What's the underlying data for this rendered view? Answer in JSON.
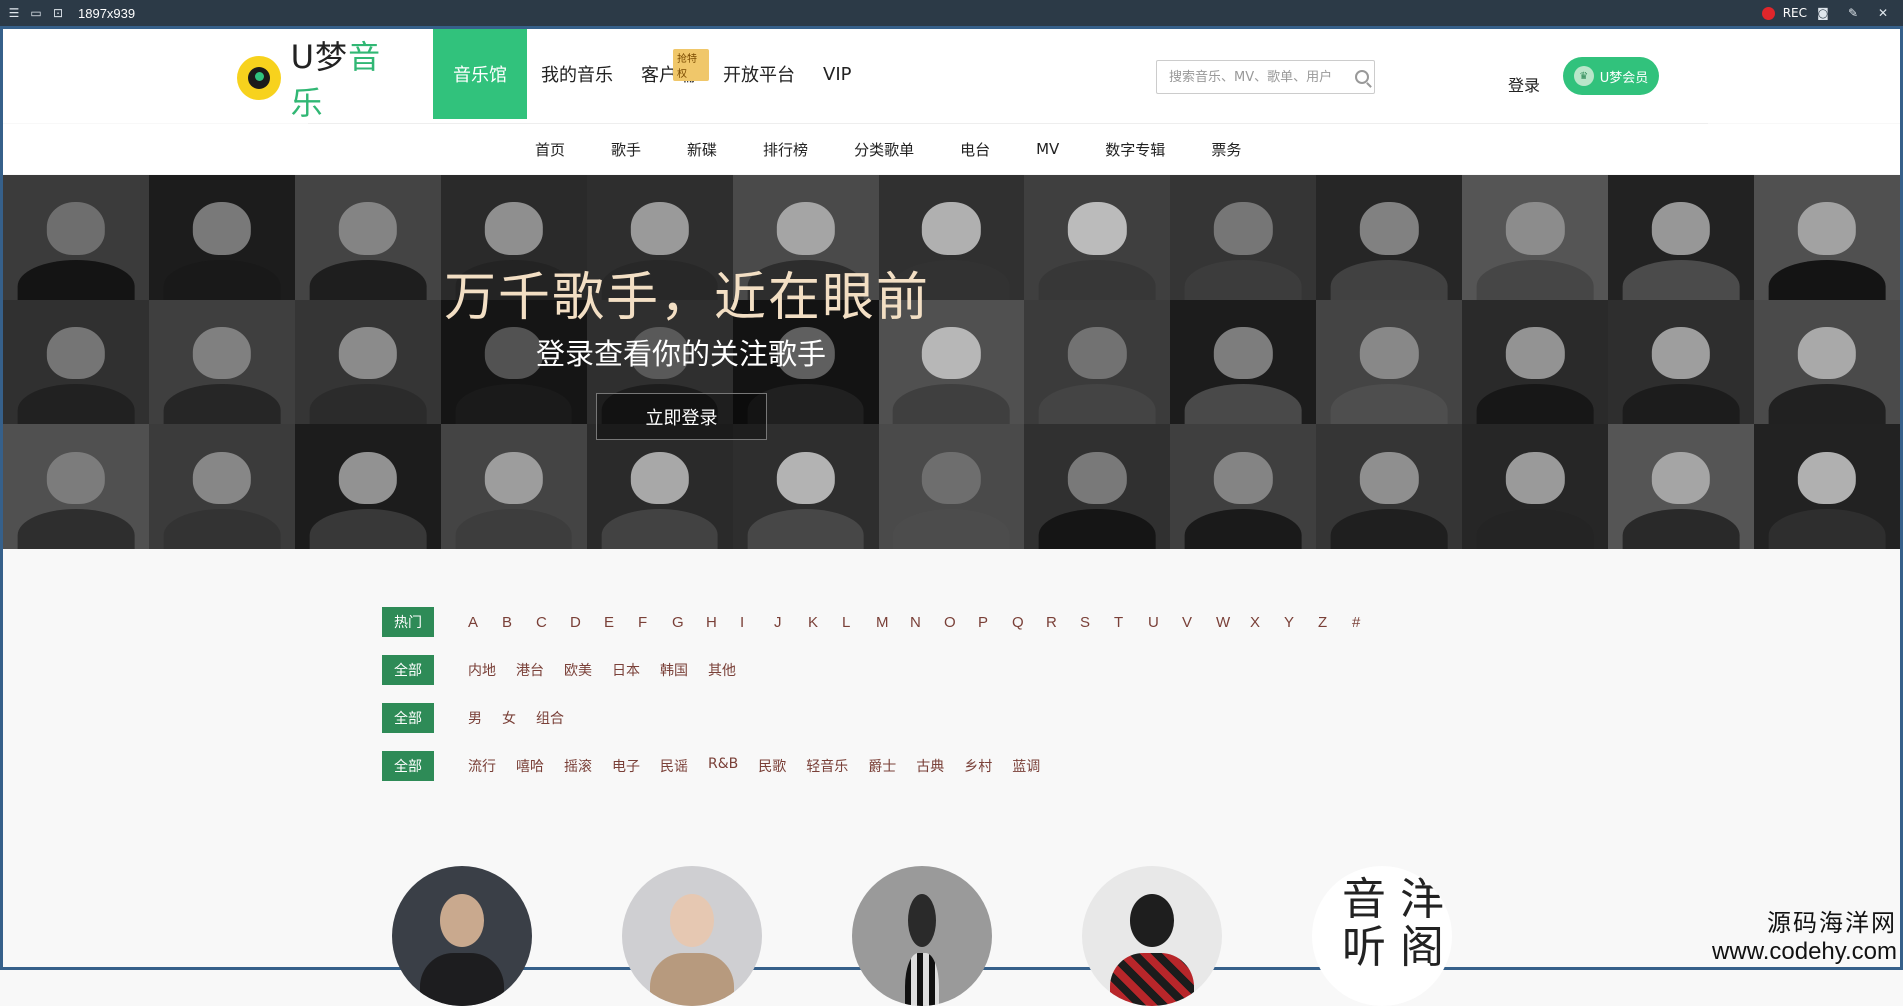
{
  "recorder": {
    "dimensions": "1897x939",
    "rec_label": "REC"
  },
  "header": {
    "brand_prefix": "U梦",
    "brand_suffix": "音乐",
    "nav": [
      {
        "label": "音乐馆"
      },
      {
        "label": "我的音乐"
      },
      {
        "label": "客户端",
        "badge": "抢特权"
      },
      {
        "label": "开放平台"
      },
      {
        "label": "VIP"
      }
    ],
    "search_placeholder": "搜索音乐、MV、歌单、用户",
    "login_label": "登录",
    "vip_button_label": "U梦会员"
  },
  "subnav": [
    "首页",
    "歌手",
    "新碟",
    "排行榜",
    "分类歌单",
    "电台",
    "MV",
    "数字专辑",
    "票务"
  ],
  "banner": {
    "title": "万千歌手，近在眼前",
    "subtitle": "登录查看你的关注歌手",
    "button": "立即登录"
  },
  "filters": {
    "letters": {
      "tag": "热门",
      "options": [
        "A",
        "B",
        "C",
        "D",
        "E",
        "F",
        "G",
        "H",
        "I",
        "J",
        "K",
        "L",
        "M",
        "N",
        "O",
        "P",
        "Q",
        "R",
        "S",
        "T",
        "U",
        "V",
        "W",
        "X",
        "Y",
        "Z",
        "#"
      ]
    },
    "regions": {
      "tag": "全部",
      "options": [
        "内地",
        "港台",
        "欧美",
        "日本",
        "韩国",
        "其他"
      ]
    },
    "gender": {
      "tag": "全部",
      "options": [
        "男",
        "女",
        "组合"
      ]
    },
    "genres": {
      "tag": "全部",
      "options": [
        "流行",
        "嘻哈",
        "摇滚",
        "电子",
        "民谣",
        "R&B",
        "民歌",
        "轻音乐",
        "爵士",
        "古典",
        "乡村",
        "蓝调"
      ]
    }
  },
  "singer_art_text": "音 洋 听 阁",
  "watermark": {
    "name": "源码海洋网",
    "url": "www.codehy.com"
  }
}
